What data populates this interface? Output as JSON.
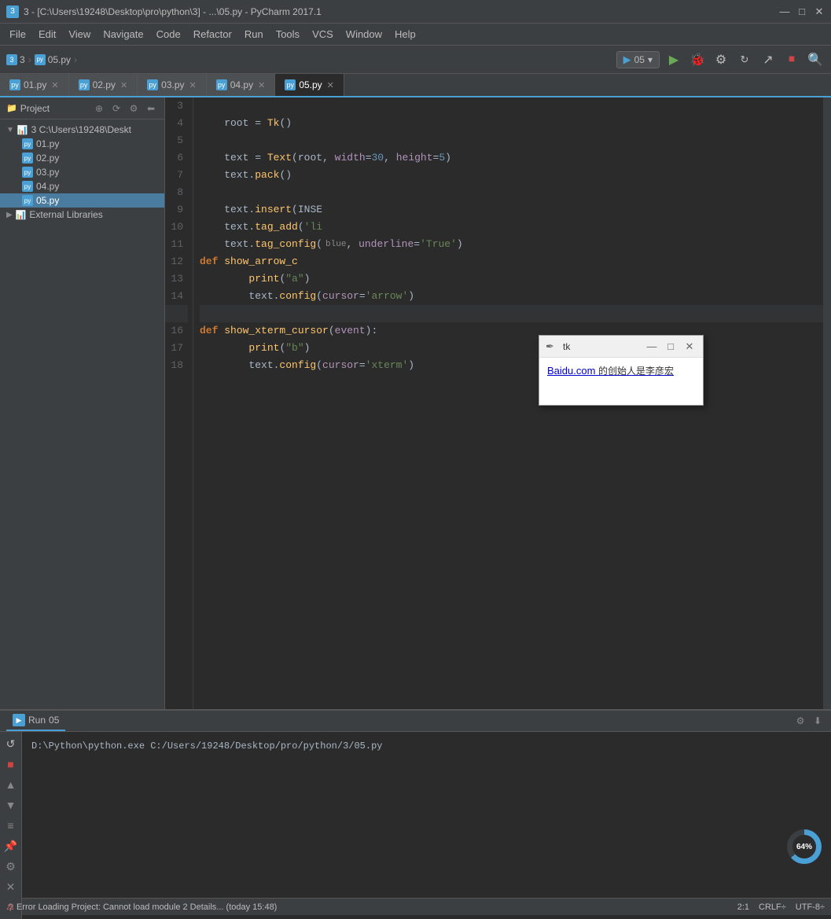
{
  "titleBar": {
    "icon": "3",
    "title": "3 - [C:\\Users\\19248\\Desktop\\pro\\python\\3] - ...\\05.py - PyCharm 2017.1",
    "minimizeBtn": "—",
    "maximizeBtn": "□",
    "closeBtn": "✕"
  },
  "menuBar": {
    "items": [
      "File",
      "Edit",
      "View",
      "Navigate",
      "Code",
      "Refactor",
      "Run",
      "Tools",
      "VCS",
      "Window",
      "Help"
    ]
  },
  "toolbar": {
    "breadcrumb": {
      "project": "3",
      "file": "05.py",
      "sep": "›"
    },
    "runConfig": "05",
    "buttons": [
      "▶",
      "🐛",
      "⚙",
      "⟳",
      "↗",
      "⏹",
      "🔍"
    ]
  },
  "tabs": [
    {
      "label": "01.py",
      "active": false
    },
    {
      "label": "02.py",
      "active": false
    },
    {
      "label": "03.py",
      "active": false
    },
    {
      "label": "04.py",
      "active": false
    },
    {
      "label": "05.py",
      "active": true
    }
  ],
  "projectPanel": {
    "title": "Project",
    "rootLabel": "3  C:\\Users\\19248\\Deskt",
    "files": [
      {
        "name": "01.py",
        "selected": false
      },
      {
        "name": "02.py",
        "selected": false
      },
      {
        "name": "03.py",
        "selected": false
      },
      {
        "name": "04.py",
        "selected": false
      },
      {
        "name": "05.py",
        "selected": true
      }
    ],
    "externalLibs": "External Libraries"
  },
  "codeLines": [
    {
      "num": "3",
      "content": ""
    },
    {
      "num": "4",
      "content": "    root = Tk()"
    },
    {
      "num": "5",
      "content": ""
    },
    {
      "num": "6",
      "content": "    text = Text(root, width=30, height=5)"
    },
    {
      "num": "7",
      "content": "    text.pack()"
    },
    {
      "num": "8",
      "content": ""
    },
    {
      "num": "9",
      "content": "    text.insert(INSE"
    },
    {
      "num": "10",
      "content": "    text.tag_add('li"
    },
    {
      "num": "11",
      "content": "    text.tag_config("
    },
    {
      "num": "12",
      "content": "def show_arrow_c"
    },
    {
      "num": "13",
      "content": "        print(\"a\")"
    },
    {
      "num": "14",
      "content": "        text.config(cursor='arrow')"
    },
    {
      "num": "15",
      "content": ""
    },
    {
      "num": "16",
      "content": "def show_xterm_cursor(event):"
    },
    {
      "num": "17",
      "content": "        print(\"b\")"
    },
    {
      "num": "18",
      "content": "        text.config(cursor='xterm')"
    }
  ],
  "tkWindow": {
    "title": "tk",
    "minimizeBtn": "—",
    "maximizeBtn": "□",
    "closeBtn": "✕",
    "content": "Baidu.com的创始人是李彦宏"
  },
  "runPanel": {
    "tabLabel": "Run",
    "runName": "05",
    "outputLines": [
      "D:\\Python\\python.exe C:/Users/19248/Desktop/pro/python/3/05.py"
    ]
  },
  "statusBar": {
    "errorMsg": "Error Loading Project: Cannot load module 2 Details... (today 15:48)",
    "position": "2:1",
    "lineEnding": "CRLF÷",
    "encoding": "UTF-8÷"
  },
  "progress": {
    "value": "64%"
  }
}
